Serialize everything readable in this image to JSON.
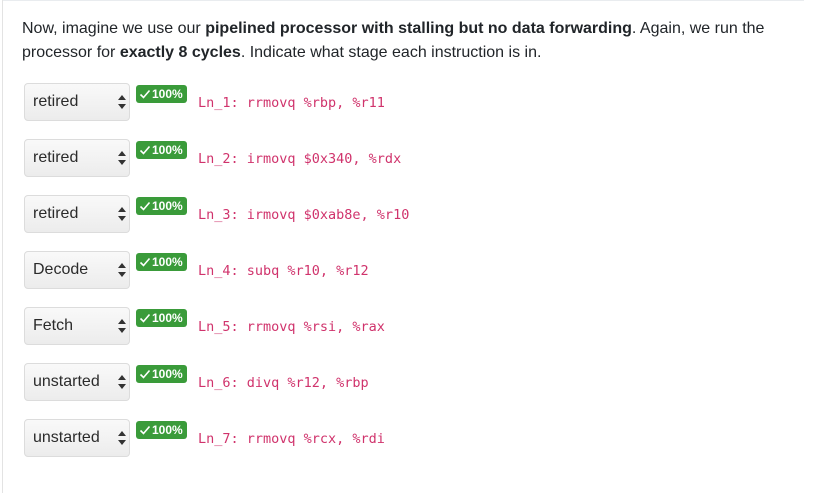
{
  "prompt": {
    "part1": "Now, imagine we use our ",
    "bold1": "pipelined processor with stalling but no data forwarding",
    "part2": ". Again, we run the processor for ",
    "bold2": "exactly 8 cycles",
    "part3": ". Indicate what stage each instruction is in."
  },
  "questions": [
    {
      "selected": "retired",
      "badge": "100%",
      "code": "Ln_1: rrmovq %rbp, %r11"
    },
    {
      "selected": "retired",
      "badge": "100%",
      "code": "Ln_2: irmovq $0x340, %rdx"
    },
    {
      "selected": "retired",
      "badge": "100%",
      "code": "Ln_3: irmovq $0xab8e, %r10"
    },
    {
      "selected": "Decode",
      "badge": "100%",
      "code": "Ln_4: subq %r10, %r12"
    },
    {
      "selected": "Fetch",
      "badge": "100%",
      "code": "Ln_5: rrmovq %rsi, %rax"
    },
    {
      "selected": "unstarted",
      "badge": "100%",
      "code": "Ln_6: divq %r12, %rbp"
    },
    {
      "selected": "unstarted",
      "badge": "100%",
      "code": "Ln_7: rrmovq %rcx, %rdi"
    }
  ],
  "colors": {
    "badge_green": "#3a9b3a",
    "code_pink": "#d0336c"
  },
  "icons": {
    "select_arrows": "updown-arrows-icon",
    "badge_check": "check-icon"
  }
}
